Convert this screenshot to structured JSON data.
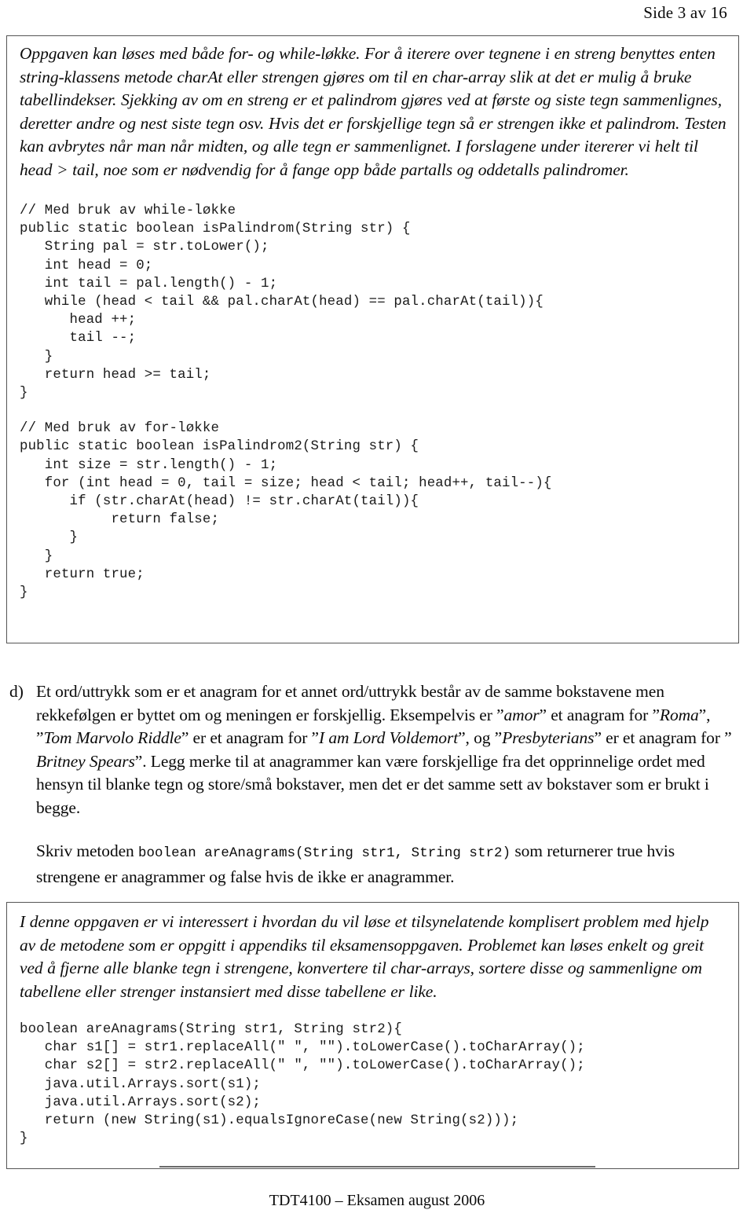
{
  "header": {
    "page_indicator": "Side 3 av 16"
  },
  "solution_box": {
    "explanation": "Oppgaven kan løses med både for- og while-løkke. For å iterere over tegnene i en streng benyttes enten string-klassens metode charAt eller strengen gjøres om til en char-array slik at det er mulig å bruke tabellindekser. Sjekking av om en streng er et palindrom gjøres ved at første og siste tegn sammenlignes, deretter andre og nest siste tegn osv. Hvis det er forskjellige tegn så er strengen ikke et palindrom. Testen kan avbrytes når man når midten, og alle tegn er sammenlignet. I forslagene under itererer vi helt til head > tail, noe som er nødvendig for å fange opp både partalls og oddetalls palindromer.",
    "code_while": "// Med bruk av while-løkke\npublic static boolean isPalindrom(String str) {\n   String pal = str.toLower();\n   int head = 0;\n   int tail = pal.length() - 1;\n   while (head < tail && pal.charAt(head) == pal.charAt(tail)){\n      head ++;\n      tail --;\n   }\n   return head >= tail;\n}",
    "code_for": "// Med bruk av for-løkke\npublic static boolean isPalindrom2(String str) {\n   int size = str.length() - 1;\n   for (int head = 0, tail = size; head < tail; head++, tail--){\n      if (str.charAt(head) != str.charAt(tail)){\n           return false;\n      }\n   }\n   return true;\n}"
  },
  "question_d": {
    "marker": "d)",
    "paragraph1": {
      "seg1": "Et ord/uttrykk som er et anagram for et annet ord/uttrykk består av de samme bokstavene men rekkefølgen er byttet om og meningen er forskjellig. Eksempelvis er ”",
      "em1": "amor",
      "seg2": "” et anagram for ”",
      "em2": "Roma",
      "seg3": "”, ”",
      "em3": "Tom Marvolo Riddle",
      "seg4": "” er et anagram for ”",
      "em4": "I am Lord Voldemort",
      "seg5": "”, og ”",
      "em5": "Presbyterians",
      "seg6": "” er et anagram for ” ",
      "em6": "Britney Spears",
      "seg7": "”. Legg merke til at anagrammer kan være forskjellige fra det opprinnelige ordet med hensyn til blanke tegn og store/små bokstaver, men det er det samme sett av bokstaver som er brukt i begge."
    },
    "paragraph2": {
      "seg1": "Skriv metoden ",
      "code1": "boolean areAnagrams(String str1, String str2)",
      "seg2": " som returnerer true hvis strengene er anagrammer og false hvis de ikke er anagrammer."
    }
  },
  "info_box": {
    "explanation": "I denne oppgaven er vi interessert i hvordan du vil løse et tilsynelatende komplisert problem med hjelp av de metodene som er oppgitt i appendiks til eksamensoppgaven. Problemet kan løses enkelt og greit ved å fjerne alle blanke tegn i strengene, konvertere til char-arrays, sortere disse og sammenligne om tabellene eller strenger instansiert med disse tabellene er like.",
    "code_anagram": "boolean areAnagrams(String str1, String str2){\n   char s1[] = str1.replaceAll(\" \", \"\").toLowerCase().toCharArray();\n   char s2[] = str2.replaceAll(\" \", \"\").toLowerCase().toCharArray();\n   java.util.Arrays.sort(s1);\n   java.util.Arrays.sort(s2);\n   return (new String(s1).equalsIgnoreCase(new String(s2)));\n}"
  },
  "footer": {
    "text": "TDT4100 – Eksamen august 2006"
  }
}
